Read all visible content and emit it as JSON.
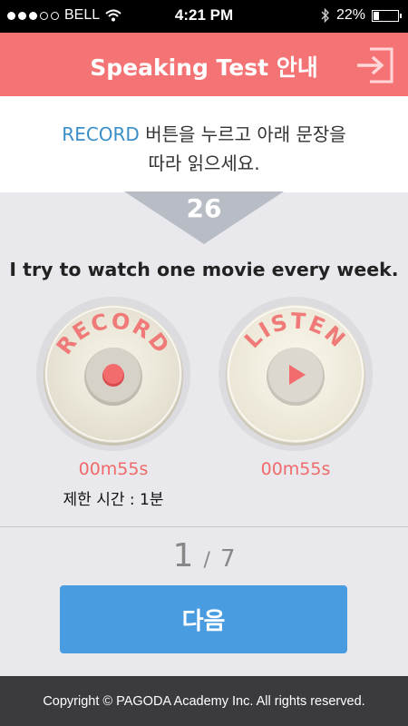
{
  "status_bar": {
    "carrier": "BELL",
    "time": "4:21 PM",
    "battery_text": "22%",
    "battery_level": 0.22,
    "signal_bars_filled": 3,
    "signal_bars_total": 5,
    "wifi_icon": "wifi-icon",
    "bluetooth_icon": "bluetooth-icon"
  },
  "header": {
    "title": "Speaking Test 안내",
    "exit_icon": "exit-icon",
    "background_color": "#f47475"
  },
  "instruction": {
    "highlight": "RECORD",
    "rest_line1": " 버튼을 누르고 아래 문장을",
    "line2": "따라 읽으세요.",
    "highlight_color": "#3a8fc8"
  },
  "question": {
    "number": "26",
    "sentence": "I try to watch one movie every week."
  },
  "record": {
    "label": "RECORD",
    "time": "00m55s",
    "icon": "record-dot-icon"
  },
  "listen": {
    "label": "LISTEN",
    "time": "00m55s",
    "icon": "play-icon"
  },
  "limit_text": "제한 시간 : 1분",
  "pager": {
    "current": "1",
    "separator": "/",
    "total": "7"
  },
  "next_button": {
    "label": "다음",
    "color": "#4a9ce0"
  },
  "footer": {
    "copyright": "Copyright © PAGODA Academy Inc. All rights reserved."
  }
}
